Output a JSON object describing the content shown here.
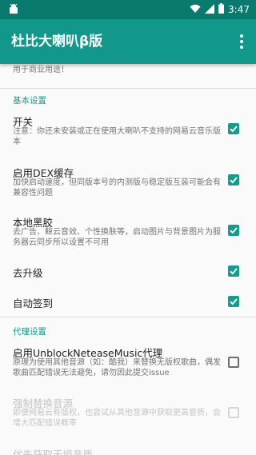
{
  "status_bar": {
    "time": "3:47"
  },
  "app_bar": {
    "title": "杜比大喇叭β版"
  },
  "welcome_text": "欢迎使用杜比大喇叭，本模块仅供学习交流使用且公开免费，严禁用于商业用途！",
  "sections": {
    "basic": "基本设置",
    "proxy": "代理设置"
  },
  "prefs": {
    "switch": {
      "title": "开关",
      "summary": "注意：你还未安装或正在使用大喇叭不支持的网易云音乐版本",
      "checked": true
    },
    "dex_cache": {
      "title": "启用DEX缓存",
      "summary": "加快启动速度，但同版本号的内测版与稳定版互装可能会有兼容性问题",
      "checked": true
    },
    "local_black": {
      "title": "本地黑胶",
      "summary": "去广告、鲸云音效、个性换肤等，启动图片与背景图片为服务器云同步所以设置不可用",
      "checked": true
    },
    "no_upgrade": {
      "title": "去升级",
      "checked": true
    },
    "auto_sign": {
      "title": "自动签到",
      "checked": true
    },
    "unblock": {
      "title": "启用UnblockNeteaseMusic代理",
      "summary": "原理为使用其他音源（如：酷我）来替换无版权歌曲，偶发歌曲匹配错误无法避免，请勿因此提交issue",
      "checked": false
    },
    "force_replace": {
      "title": "强制替换音源",
      "summary": "即便网易云有版权，也尝试从其他音源中获取更高音质，会增大匹配错误概率",
      "checked": false
    },
    "priority_lossless": {
      "title": "优先获取无损音质"
    }
  },
  "colors": {
    "accent": "#169b8d",
    "app_bar": "#12988a",
    "status_bar": "#0a7a6e"
  }
}
